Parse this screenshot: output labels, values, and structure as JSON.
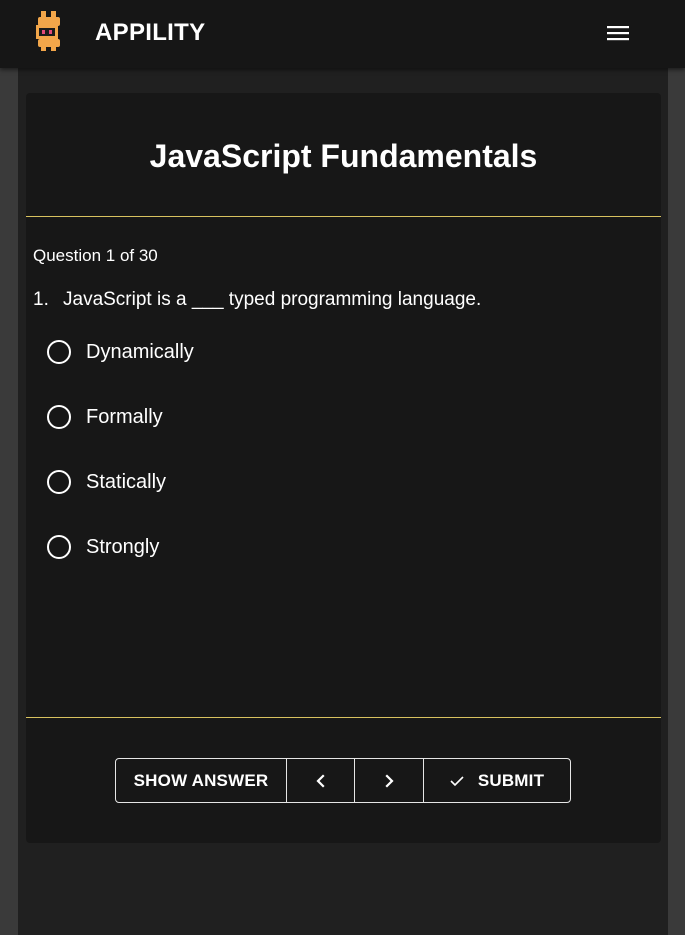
{
  "app": {
    "name": "APPILITY"
  },
  "icons": {
    "logo": "appility-logo-icon",
    "menu": "hamburger-menu-icon",
    "prev": "chevron-left-icon",
    "next": "chevron-right-icon",
    "submit": "check-icon"
  },
  "colors": {
    "appbar": "#161616",
    "card": "#171717",
    "divider": "#d8c25f",
    "logo_orange": "#f2a64a",
    "logo_pink": "#e24a78",
    "text": "#ffffff"
  },
  "quiz": {
    "title": "JavaScript Fundamentals",
    "progress": "Question 1 of 30",
    "question_number": "1.",
    "question_text": "JavaScript is a ___ typed programming language.",
    "options": [
      "Dynamically",
      "Formally",
      "Statically",
      "Strongly"
    ]
  },
  "actions": {
    "show_answer": "SHOW ANSWER",
    "submit": "SUBMIT"
  }
}
